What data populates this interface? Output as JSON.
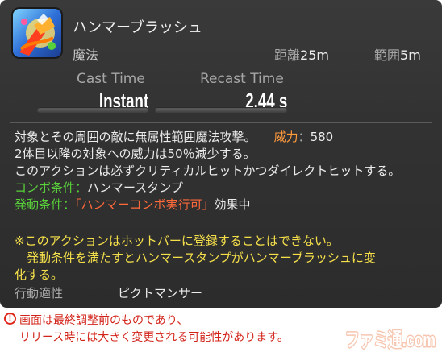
{
  "action": {
    "name": "ハンマーブラッシュ",
    "type": "魔法",
    "range_label": "距離",
    "range_value": "25m",
    "radius_label": "範囲",
    "radius_value": "5m"
  },
  "timing": {
    "cast_label": "Cast Time",
    "cast_value": "Instant",
    "recast_label": "Recast Time",
    "recast_value": "2.44 s"
  },
  "description": {
    "line1_text": "対象とその周囲の敵に無属性範囲魔法攻撃。",
    "potency_label": "威力",
    "potency_sep": "：",
    "potency_value": "580",
    "line2": "2体目以降の対象への威力は50％減少する。",
    "line3": "このアクションは必ずクリティカルヒットかつダイレクトヒットする。",
    "combo_label": "コンボ条件",
    "combo_sep": "：",
    "combo_value": "ハンマースタンプ",
    "activation_label": "発動条件",
    "activation_sep": "：",
    "activation_value": "「ハンマーコンボ実行可」",
    "activation_suffix": "効果中",
    "note_line1": "※このアクションはホットバーに登録することはできない。",
    "note_line2": "　発動条件を満たすとハンマースタンプがハンマーブラッシュに変",
    "note_line3": "化する。"
  },
  "job": {
    "label": "行動適性",
    "value": "ピクトマンサー"
  },
  "footer": {
    "warning_line1": "画面は最終調整前のものであり、",
    "warning_line2": "リリース時には大きく変更される可能性があります。",
    "logo_text": "ファミ通.com"
  },
  "colors": {
    "accent_orange": "#ff9a3c",
    "combo_green": "#59d13a",
    "activation_red": "#ff6a3a",
    "note_yellow": "#f5e04a",
    "warning_red": "#d3241a"
  },
  "icons": {
    "action_icon": "hammer-brush-icon",
    "warning_icon": "exclamation-circle-icon"
  }
}
